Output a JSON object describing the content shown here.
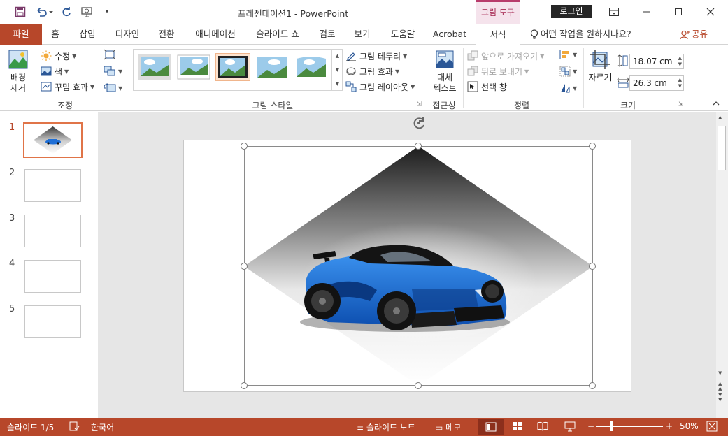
{
  "titlebar": {
    "doc_title": "프레젠테이션1  -  PowerPoint",
    "contextual_group": "그림 도구",
    "login": "로그인"
  },
  "tabs": {
    "file": "파일",
    "home": "홈",
    "insert": "삽입",
    "design": "디자인",
    "transitions": "전환",
    "animations": "애니메이션",
    "slideshow": "슬라이드 쇼",
    "review": "검토",
    "view": "보기",
    "help": "도움말",
    "acrobat": "Acrobat",
    "format": "서식",
    "tellme": "어떤 작업을 원하시나요?",
    "share": "공유"
  },
  "ribbon": {
    "adjust": {
      "remove_bg": "배경\n제거",
      "corrections": "수정",
      "color": "색",
      "artistic": "꾸밈 효과",
      "label": "조정"
    },
    "styles": {
      "border": "그림 테두리",
      "effects": "그림 효과",
      "layout": "그림 레이아웃",
      "label": "그림 스타일"
    },
    "accessibility": {
      "alt_text": "대체\n텍스트",
      "label": "접근성"
    },
    "arrange": {
      "bring_forward": "앞으로 가져오기",
      "send_backward": "뒤로 보내기",
      "selection_pane": "선택 창",
      "label": "정렬"
    },
    "size": {
      "crop": "자르기",
      "height": "18.07 cm",
      "width": "26.3 cm",
      "label": "크기"
    }
  },
  "slides": [
    {
      "num": "1"
    },
    {
      "num": "2"
    },
    {
      "num": "3"
    },
    {
      "num": "4"
    },
    {
      "num": "5"
    }
  ],
  "statusbar": {
    "slide_count": "슬라이드 1/5",
    "language": "한국어",
    "notes": "슬라이드 노트",
    "comments": "메모",
    "zoom": "50%"
  },
  "colors": {
    "accent": "#b7472a",
    "contextual": "#b83b6b",
    "selected_thumb_border": "#e07448"
  }
}
